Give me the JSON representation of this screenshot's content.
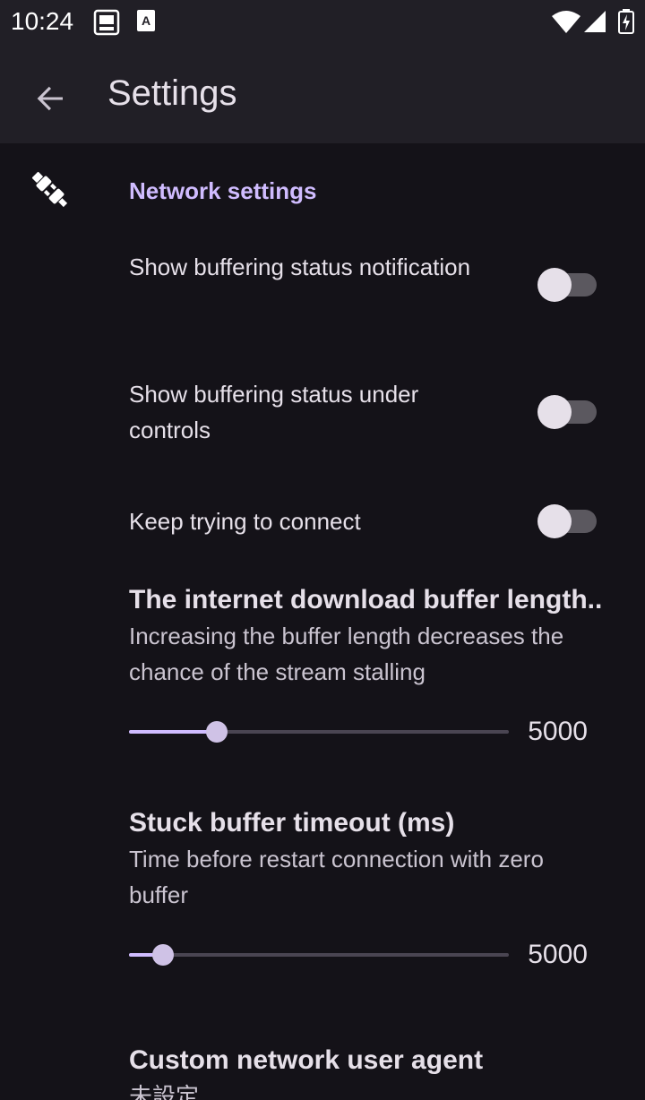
{
  "status_bar": {
    "time": "10:24",
    "icons": [
      "sim-card-icon",
      "keyboard-a-icon",
      "wifi-icon",
      "signal-icon",
      "battery-charging-icon"
    ]
  },
  "app_bar": {
    "title": "Settings",
    "back_icon": "arrow-back-icon"
  },
  "category": {
    "icon": "plug-icon",
    "title": "Network settings"
  },
  "switches": [
    {
      "title": "Show buffering status notification",
      "checked": false
    },
    {
      "title": "Show buffering status under controls",
      "checked": false
    },
    {
      "title": "Keep trying to connect",
      "checked": false
    }
  ],
  "sliders": [
    {
      "title": "The internet download buffer length..",
      "summary": "Increasing the buffer length decreases the chance of the stream stalling",
      "value": "5000",
      "fraction": 0.23
    },
    {
      "title": "Stuck buffer timeout (ms)",
      "summary": "Time before restart connection with zero buffer",
      "value": "5000",
      "fraction": 0.09
    }
  ],
  "user_agent": {
    "title": "Custom network user agent",
    "summary": "未設定"
  },
  "colors": {
    "background": "#141218",
    "app_bar": "#211f26",
    "accent": "#d0bcff"
  }
}
